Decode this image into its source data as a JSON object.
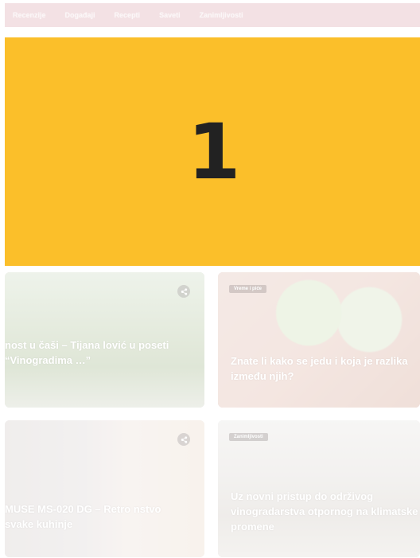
{
  "nav": {
    "items": [
      "Recenzije",
      "Događaji",
      "Recepti",
      "Saveti",
      "Zanimljivosti"
    ]
  },
  "banner": {
    "number": "1"
  },
  "cards": [
    {
      "category": "",
      "title": "nost u čaši – Tijana lović u poseti “Vinogradima …” "
    },
    {
      "category": "Vreme i piće",
      "title": "Znate li kako se jedu i koja je razlika između njih?"
    },
    {
      "category": "",
      "title": "MUSE MS-020 DG – Retro nstvo svake kuhinje"
    },
    {
      "category": "Zanimljivosti",
      "title": "Uz novni pristup do održivog vinogradarstva otpornog na klimatske promene"
    }
  ],
  "icons": {
    "share": "share-icon"
  },
  "colors": {
    "banner": "#fbbf2a",
    "nav_bg": "#f3e1e4"
  }
}
